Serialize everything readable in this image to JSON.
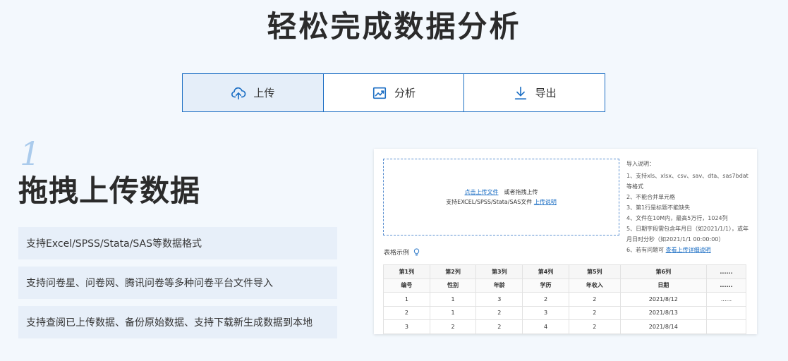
{
  "page_title": "轻松完成数据分析",
  "tabs": [
    {
      "label": "上传",
      "icon": "cloud-upload-icon",
      "active": true
    },
    {
      "label": "分析",
      "icon": "chart-analysis-icon",
      "active": false
    },
    {
      "label": "导出",
      "icon": "download-icon",
      "active": false
    }
  ],
  "step": {
    "number": "1",
    "title": "拖拽上传数据",
    "features": [
      "支持Excel/SPSS/Stata/SAS等数据格式",
      "支持问卷星、问卷网、腾讯问卷等多种问卷平台文件导入",
      "支持查阅已上传数据、备份原始数据、支持下载新生成数据到本地"
    ]
  },
  "upload": {
    "click_link": "点击上传文件",
    "or_drag": "或者拖拽上传",
    "support_text": "支持EXCEL/SPSS/Stata/SAS文件",
    "help_link": "上传说明"
  },
  "notes": {
    "title": "导入说明：",
    "items": [
      "1、支持xls、xlsx、csv、sav、dta、sas7bdat等格式",
      "2、不能合并单元格",
      "3、第1行是标题不能缺失",
      "4、文件在10M内，最高5万行，1024列",
      "5、日期字段需包含年月日（如2021/1/1），或年月日时分秒（如2021/1/1 00:00:00）"
    ],
    "item6_text": "6、若有问题可",
    "item6_link": "查看上传详细说明"
  },
  "sample": {
    "label": "表格示例",
    "icon": "lightbulb-icon",
    "header": [
      "第1列",
      "第2列",
      "第3列",
      "第4列",
      "第5列",
      "第6列",
      "......"
    ],
    "subheader": [
      "编号",
      "性别",
      "年龄",
      "学历",
      "年收入",
      "日期",
      "......"
    ],
    "rows": [
      [
        "1",
        "1",
        "3",
        "2",
        "2",
        "2021/8/12",
        "......"
      ],
      [
        "2",
        "1",
        "2",
        "3",
        "2",
        "2021/8/13",
        ""
      ],
      [
        "3",
        "2",
        "2",
        "4",
        "2",
        "2021/8/14",
        ""
      ]
    ]
  },
  "colors": {
    "accent": "#1d6fc4",
    "background": "#f3f8fd",
    "feature_bg": "#e7eff9",
    "step_number": "#aacbec"
  }
}
